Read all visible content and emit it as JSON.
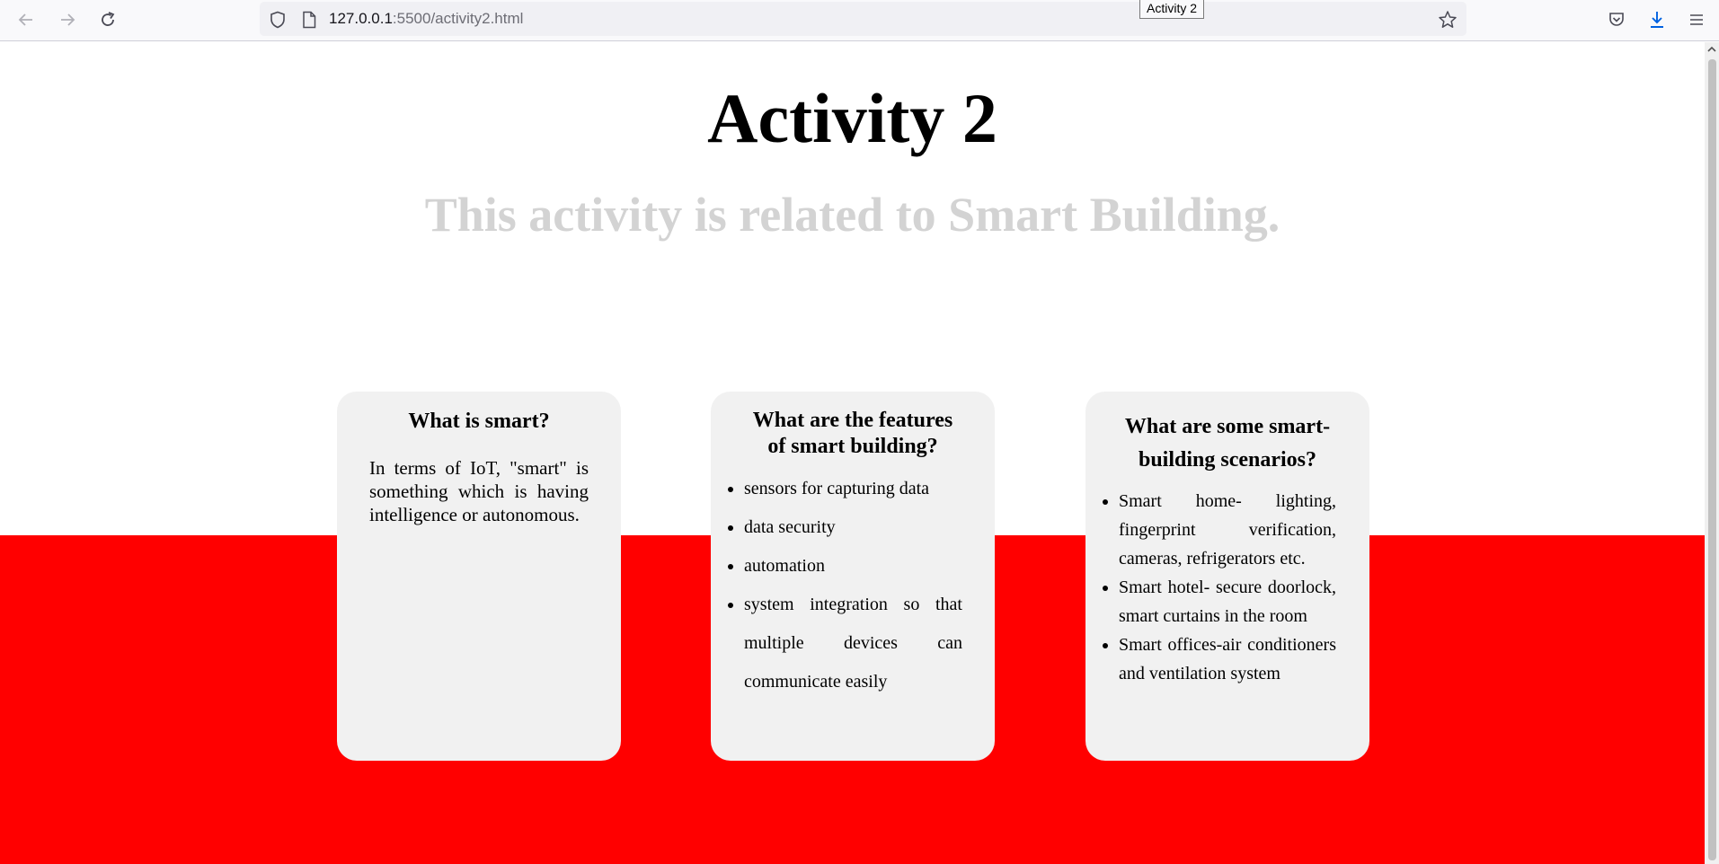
{
  "browser": {
    "url_host": "127.0.0.1",
    "url_path": ":5500/activity2.html",
    "tooltip": "Activity 2",
    "icons": {
      "back": "arrow-left-icon",
      "forward": "arrow-right-icon",
      "reload": "reload-icon",
      "shield": "shield-icon",
      "page": "page-icon",
      "bookmark": "star-icon",
      "pocket": "pocket-icon",
      "downloads": "download-icon",
      "menu": "hamburger-menu-icon"
    }
  },
  "page": {
    "title": "Activity 2",
    "subtitle": "This activity is related to Smart Building.",
    "colors": {
      "band": "#ff0000",
      "subtitle": "#d3d3d3",
      "card": "#f1f1f1"
    },
    "cards": [
      {
        "heading": "What is smart?",
        "text": "In terms of IoT, \"smart\" is something which is having intelligence or autonomous."
      },
      {
        "heading": "What are the features of smart building?",
        "items": [
          "sensors for capturing data",
          "data security",
          "automation",
          "system integration so that multiple devices can communicate easily"
        ]
      },
      {
        "heading": "What are some smart-building scenarios?",
        "items": [
          "Smart home- lighting, fingerprint verification, cameras, refrigerators etc.",
          "Smart hotel- secure doorlock, smart curtains in the room",
          "Smart offices-air conditioners and ventilation system"
        ]
      }
    ]
  }
}
